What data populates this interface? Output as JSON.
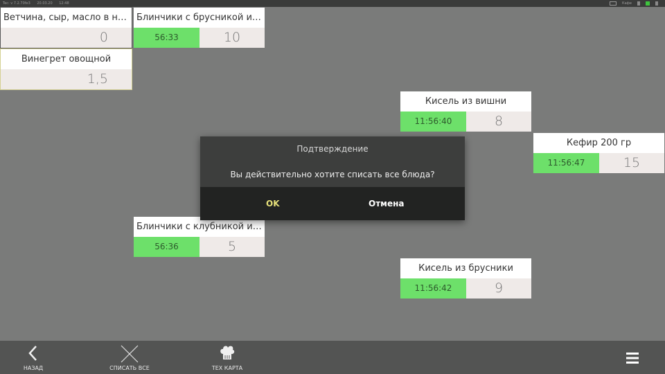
{
  "statusbar": {
    "left_items": [
      "Tec: v 7.2.70fe3",
      "20.03.20",
      "12:48"
    ],
    "user": "Кафе"
  },
  "cards": {
    "c1": {
      "title": "Ветчина, сыр, масло в нарезке",
      "time": "",
      "qty": "0"
    },
    "c2": {
      "title": "Блинчики с брусникой и бру...",
      "time": "56:33",
      "qty": "10"
    },
    "c3": {
      "title": "Винегрет овощной",
      "time": "",
      "qty": "1,5"
    },
    "c4": {
      "title": "Кисель из вишни",
      "time": "11:56:40",
      "qty": "8"
    },
    "c5": {
      "title": "Кефир 200 гр",
      "time": "11:56:47",
      "qty": "15"
    },
    "c6": {
      "title": "Блинчики с клубникой и бру...",
      "time": "56:36",
      "qty": "5"
    },
    "c7": {
      "title": "Кисель из брусники",
      "time": "11:56:42",
      "qty": "9"
    }
  },
  "dialog": {
    "title": "Подтверждение",
    "message": "Вы действительно хотите списать все блюда?",
    "ok": "OK",
    "cancel": "Отмена"
  },
  "bottombar": {
    "back": "НАЗАД",
    "writeoff_all": "СПИСАТЬ ВСЕ",
    "tech_card": "ТЕХ КАРТА"
  },
  "colors": {
    "accent_green": "#6de06a",
    "ok_yellow": "#e6e07a",
    "background": "#7a7b7a"
  }
}
